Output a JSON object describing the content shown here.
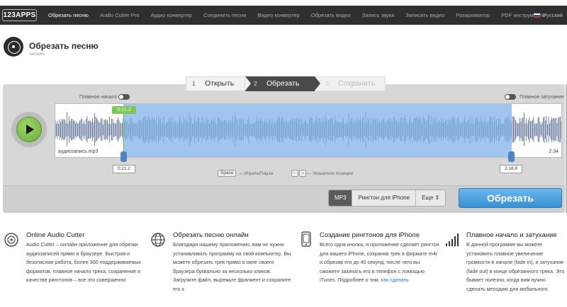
{
  "nav": {
    "logo": "123APPS",
    "items": [
      "Обрезать песню",
      "Audio Cutter Pro",
      "Аудио конвертер",
      "Соединить песни",
      "Видео конвертер",
      "Обрезать видео",
      "Запись звука",
      "Записать видео",
      "Разархиватор",
      "PDF инструменты"
    ],
    "language": "Русский"
  },
  "header": {
    "title": "Обрезать песню",
    "subtitle": "онлайн"
  },
  "steps": [
    {
      "num": "1",
      "label": "Открыть"
    },
    {
      "num": "2",
      "label": "Обрезать"
    },
    {
      "num": "3",
      "label": "Сохранить"
    }
  ],
  "editor": {
    "fade_in_label": "Плавное начало",
    "fade_out_label": "Плавное затухание",
    "file_name": "аудиозапись.mp3",
    "duration": "2:34",
    "start_tag": "0:21.2",
    "start_time": "0:21.2",
    "end_time": "2:18.8",
    "hint_space_key": "Space",
    "hint_space_text": "— Играть/Пауза",
    "hint_arrow_left": "←",
    "hint_arrow_right": "→",
    "hint_arrows_text": "— Указатели позиции",
    "formats": [
      "MP3",
      "Рингтон для iPhone",
      "Еще"
    ],
    "cut_button": "Обрезать"
  },
  "features": [
    {
      "title": "Online Audio Cutter",
      "text": "Audio Cutter – онлайн приложение для обрезки аудиозаписей прямо в браузере. Быстрая и безопасная работа, более 300 поддерживаемых форматов, плавное начало трека, сохранение в качестве рингтонов – все это совершенно"
    },
    {
      "title": "Обрезать песню онлайн",
      "text": "Благодаря нашему приложению, вам не нужно устанавливать программу на свой компьютер. Вы можете обрезать трек прямо в окне своего браузера буквально за несколько кликов. Загрузите файл, вырежьте фрагмент и сохраните его к"
    },
    {
      "title": "Создание рингтонов для iPhone",
      "text": "Всего одна кнопка, и приложение сделает рингтон для вашего iPhone, сохранив трек в формате m4r и обрезав его до 40 секунд, после чего вы сможете закачать его в телефон с помощью iTunes. Подробнее о том,",
      "link": "как сделать"
    },
    {
      "title": "Плавное начало и затухание",
      "text": "В данной программе вы можете установить плавное увеличение громкости в начале (fade in), и затухание (fade out) в конце обрезанного трека. Это бывает полезно, когда вам нужно сделать мелодию для мобильного"
    }
  ]
}
